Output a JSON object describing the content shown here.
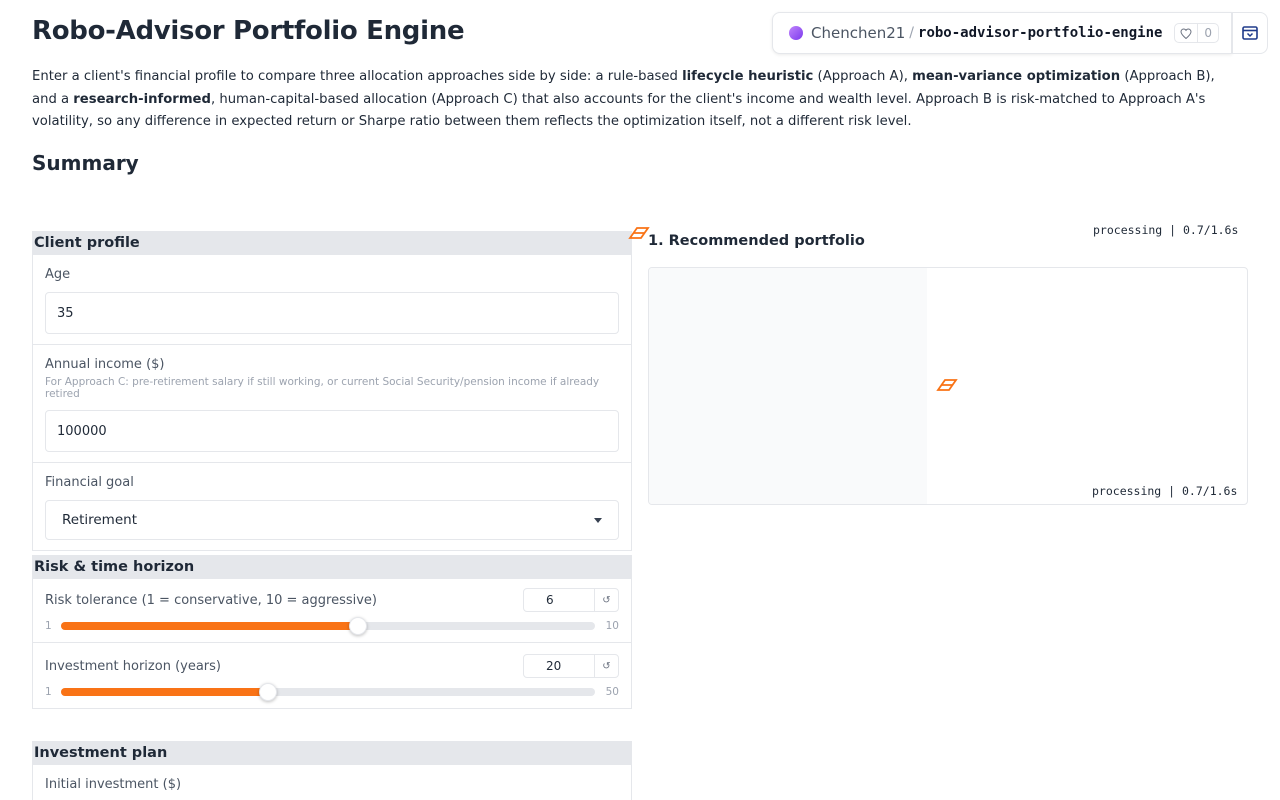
{
  "app": {
    "title": "Robo-Advisor Portfolio Engine",
    "space_user": "Chenchen21",
    "space_separator": "/",
    "space_repo": "robo-advisor-portfolio-engine",
    "likes": "0"
  },
  "intro": {
    "p1": "Enter a client's financial profile to compare three allocation approaches side by side: a rule-based ",
    "b1": "lifecycle heuristic",
    "p2": " (Approach A), ",
    "b2": "mean-variance optimization",
    "p3": " (Approach B), and a ",
    "b3": "research-informed",
    "p4": ", human-capital-based allocation (Approach C) that also accounts for the client's income and wealth level. Approach B is risk-matched to Approach A's volatility, so any difference in expected return or Sharpe ratio between them reflects the optimization itself, not a different risk level."
  },
  "summary_heading": "Summary",
  "client_profile": {
    "heading": "Client profile",
    "age_label": "Age",
    "age_value": "35",
    "income_label": "Annual income ($)",
    "income_info": "For Approach C: pre-retirement salary if still working, or current Social Security/pension income if already retired",
    "income_value": "100000",
    "goal_label": "Financial goal",
    "goal_value": "Retirement"
  },
  "risk_horizon": {
    "heading": "Risk & time horizon",
    "risk_label": "Risk tolerance (1 = conservative, 10 = aggressive)",
    "risk_value": "6",
    "risk_min": "1",
    "risk_max": "10",
    "risk_fraction": 0.5556,
    "horizon_label": "Investment horizon (years)",
    "horizon_value": "20",
    "horizon_min": "1",
    "horizon_max": "50",
    "horizon_fraction": 0.3878,
    "reset_icon": "reset-icon"
  },
  "investment_plan": {
    "heading": "Investment plan",
    "initial_label": "Initial investment ($)"
  },
  "output": {
    "rec_title": "1. Recommended portfolio",
    "status_top": "processing | 0.7/1.6s",
    "status_plot": "processing | 0.7/1.6s"
  },
  "colors": {
    "accent": "#f97316",
    "group_header": "#e5e7eb",
    "border": "#e5e7eb"
  }
}
